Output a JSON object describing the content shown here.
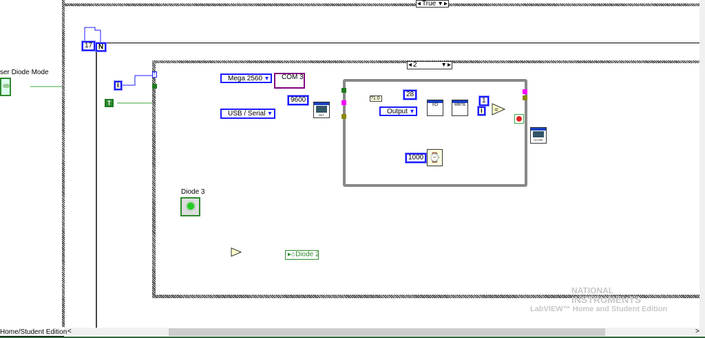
{
  "outer_case": {
    "selector": "True"
  },
  "loop_count_constant": "17",
  "for_loop_count_terminal": "N",
  "left_control": {
    "label": "ser Diode Mode"
  },
  "for_iteration_terminal": "i",
  "true_constant": "T",
  "inner_case": {
    "selector": "2"
  },
  "board_enum": "Mega 2560",
  "com_resource": "COM 3",
  "baud_constant": "9600",
  "connection_enum": "USB / Serial",
  "init_node": "INIT",
  "pin_constant": "28",
  "mode_enum": "Output",
  "io_node": "I/O",
  "write_node": "WRITE",
  "compare_constant": "1",
  "while_iteration_terminal": "i",
  "close_node": "CLOSE",
  "wait_constant": "1000",
  "diode3": {
    "label": "Diode 3"
  },
  "diode2_local": "Diode 2",
  "status_bar": {
    "text": "Home/Student Edition"
  },
  "watermark": {
    "line1": "NATIONAL",
    "line2": "INSTRUMENTS",
    "line3": "LabVIEW™ Home and Student Edition"
  },
  "colors": {
    "numeric_wire": "#1a1aff",
    "boolean_wire": "#2d8a2d",
    "resource_wire": "#ff00ff",
    "error_wire": "#c8c800"
  }
}
